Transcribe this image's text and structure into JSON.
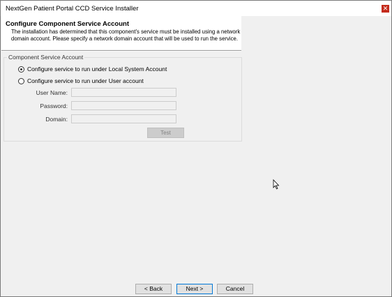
{
  "window": {
    "title": "NextGen Patient Portal CCD Service Installer",
    "close_glyph": "✕"
  },
  "banner": {
    "title": "Configure Component Service Account",
    "description": "The installation has determined that this component's service must be installed using a network domain account. Please specify a network domain account that will be used to run the service."
  },
  "group": {
    "legend": "Component Service Account",
    "options": [
      {
        "label": "Configure service to run under Local System Account",
        "selected": true
      },
      {
        "label": "Configure service to run under User account",
        "selected": false
      }
    ],
    "fields": [
      {
        "label": "User Name:",
        "value": ""
      },
      {
        "label": "Password:",
        "value": ""
      },
      {
        "label": "Domain:",
        "value": ""
      }
    ],
    "test_label": "Test"
  },
  "footer": {
    "back_label": "< Back",
    "next_label": "Next >",
    "cancel_label": "Cancel"
  },
  "icons": {
    "close": "close-icon",
    "cursor": "mouse-cursor-icon"
  },
  "colors": {
    "close_bg": "#c42b1c",
    "default_button_border": "#0078d7"
  }
}
